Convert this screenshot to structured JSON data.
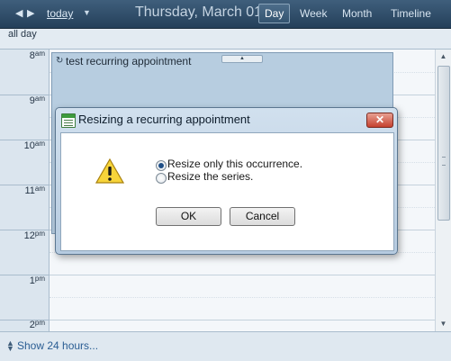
{
  "toolbar": {
    "prev_icon": "triangle-left-icon",
    "next_icon": "triangle-right-icon",
    "today_label": "today",
    "date_title": "Thursday, March 01,",
    "views": [
      "Day",
      "Week",
      "Month",
      "Timeline"
    ],
    "active_view": "Day"
  },
  "calendar": {
    "allday_label": "all day",
    "hours": [
      {
        "num": "8",
        "suffix": "am"
      },
      {
        "num": "9",
        "suffix": "am"
      },
      {
        "num": "10",
        "suffix": "am"
      },
      {
        "num": "11",
        "suffix": "am"
      },
      {
        "num": "12",
        "suffix": "pm"
      },
      {
        "num": "1",
        "suffix": "pm"
      },
      {
        "num": "2",
        "suffix": "pm"
      }
    ],
    "appointment": {
      "title": "test recurring appointment",
      "icon": "recurring-icon"
    },
    "show24_label": "Show 24 hours..."
  },
  "dialog": {
    "title": "Resizing a recurring appointment",
    "close_label": "✕",
    "options": [
      {
        "label": "Resize only this occurrence.",
        "checked": true
      },
      {
        "label": "Resize the series.",
        "checked": false
      }
    ],
    "ok_label": "OK",
    "cancel_label": "Cancel",
    "icon": "warning-icon"
  },
  "colors": {
    "toolbar": "#2f4d6a",
    "appointment": "#b7cde0",
    "dialog_frame": "#c3d6e9",
    "close_button": "#c5412f"
  }
}
